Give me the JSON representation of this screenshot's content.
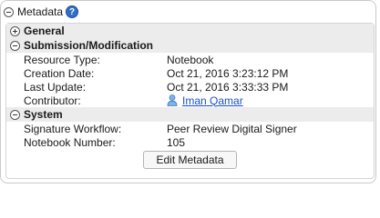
{
  "header": {
    "title": "Metadata",
    "help_label": "?"
  },
  "sections": {
    "general": {
      "label": "General"
    },
    "submission": {
      "label": "Submission/Modification",
      "rows": [
        {
          "key": "Resource Type:",
          "value": "Notebook"
        },
        {
          "key": "Creation Date:",
          "value": "Oct 21, 2016 3:23:12 PM"
        },
        {
          "key": "Last Update:",
          "value": "Oct 21, 2016 3:33:33 PM"
        },
        {
          "key": "Contributor:",
          "value": "Iman Qamar"
        }
      ]
    },
    "system": {
      "label": "System",
      "rows": [
        {
          "key": "Signature Workflow:",
          "value": "Peer Review Digital Signer"
        },
        {
          "key": "Notebook Number:",
          "value": "105"
        }
      ]
    }
  },
  "actions": {
    "edit_label": "Edit Metadata"
  },
  "colors": {
    "link": "#1a4ec9",
    "section_bg": "#ececec",
    "help_icon": "#2f6fc8"
  },
  "icons": {
    "collapse": "minus-circle-icon",
    "expand": "plus-circle-icon",
    "help": "help-icon",
    "contributor": "person-icon"
  }
}
